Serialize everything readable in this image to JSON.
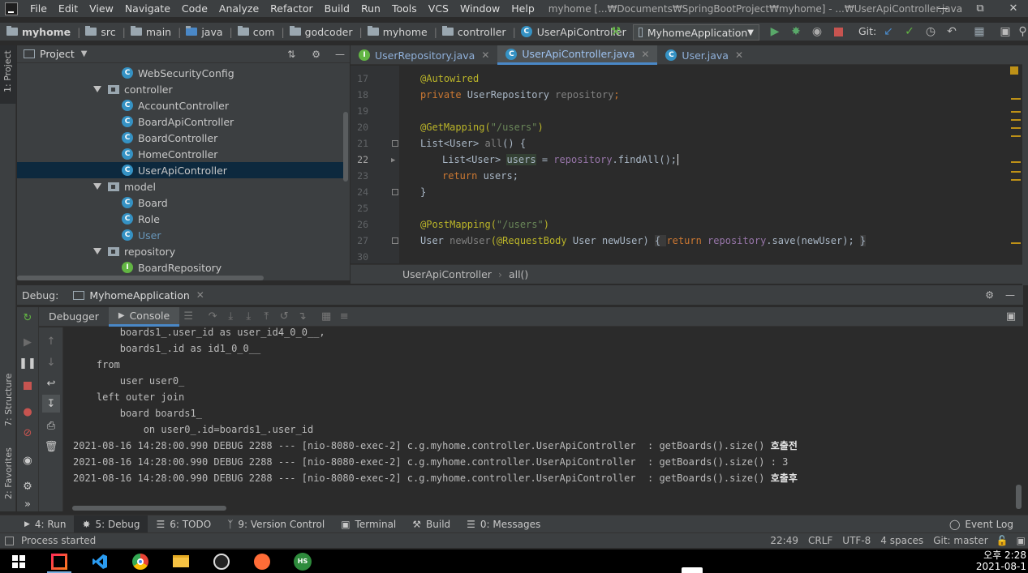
{
  "window": {
    "title": "myhome [...₩Documents₩SpringBootProject₩myhome] - ...₩UserApiController.java"
  },
  "menu": [
    "File",
    "Edit",
    "View",
    "Navigate",
    "Code",
    "Analyze",
    "Refactor",
    "Build",
    "Run",
    "Tools",
    "VCS",
    "Window",
    "Help"
  ],
  "breadcrumb": [
    "myhome",
    "src",
    "main",
    "java",
    "com",
    "godcoder",
    "myhome",
    "controller",
    "UserApiController"
  ],
  "toolbar": {
    "run_config": "MyhomeApplication",
    "git_label": "Git:"
  },
  "project_panel": {
    "title": "Project",
    "tree": [
      {
        "label": "WebSecurityConfig",
        "kind": "class"
      },
      {
        "label": "controller",
        "kind": "package"
      },
      {
        "label": "AccountController",
        "kind": "class"
      },
      {
        "label": "BoardApiController",
        "kind": "class"
      },
      {
        "label": "BoardController",
        "kind": "class"
      },
      {
        "label": "HomeController",
        "kind": "class"
      },
      {
        "label": "UserApiController",
        "kind": "class",
        "selected": true
      },
      {
        "label": "model",
        "kind": "package"
      },
      {
        "label": "Board",
        "kind": "class"
      },
      {
        "label": "Role",
        "kind": "class"
      },
      {
        "label": "User",
        "kind": "class"
      },
      {
        "label": "repository",
        "kind": "package"
      },
      {
        "label": "BoardRepository",
        "kind": "interface"
      }
    ]
  },
  "editor": {
    "tabs": [
      {
        "label": "UserRepository.java",
        "kind": "interface"
      },
      {
        "label": "UserApiController.java",
        "kind": "class",
        "active": true
      },
      {
        "label": "User.java",
        "kind": "class"
      }
    ],
    "line_numbers": [
      "17",
      "18",
      "19",
      "20",
      "21",
      "22",
      "23",
      "24",
      "25",
      "26",
      "27",
      "30"
    ],
    "code": {
      "l17_ann": "@Autowired",
      "l18_kw": "private",
      "l18_type": " UserRepository ",
      "l18_field": "repository",
      "l18_end": ";",
      "l20_ann": "@GetMapping(",
      "l20_str": "\"/users\"",
      "l20_end": ")",
      "l21_type": "List<User> ",
      "l21_name": "all",
      "l21_end": "() {",
      "l22_type": "List<User> ",
      "l22_var": "users",
      "l22_mid": " = ",
      "l22_field": "repository",
      "l22_call": ".findAll();",
      "l23_kw": "return",
      "l23_end": " users;",
      "l24": "}",
      "l26_ann": "@PostMapping(",
      "l26_str": "\"/users\"",
      "l26_end": ")",
      "l27_type": "User ",
      "l27_name": "newUser",
      "l27_ann": "(@RequestBody",
      "l27_mid": " User newUser) ",
      "l27_b1": "{ ",
      "l27_kw": "return",
      "l27_sp": " ",
      "l27_field": "repository",
      "l27_call": ".save(newUser); ",
      "l27_b2": "}"
    },
    "crumb": [
      "UserApiController",
      "all()"
    ]
  },
  "debug": {
    "label": "Debug:",
    "session": "MyhomeApplication",
    "tabs": [
      "Debugger",
      "Console"
    ],
    "console_lines": [
      "        boards1_.user_id as user_id4_0_0__,",
      "        boards1_.id as id1_0_0__",
      "    from",
      "        user user0_",
      "    left outer join",
      "        board boards1_",
      "            on user0_.id=boards1_.user_id"
    ],
    "log_lines": [
      {
        "prefix": "2021-08-16 14:28:00.990 DEBUG 2288 --- [nio-8080-exec-2] c.g.myhome.controller.UserApiController  : getBoards().size() ",
        "suffix": "호출전"
      },
      {
        "prefix": "2021-08-16 14:28:00.990 DEBUG 2288 --- [nio-8080-exec-2] c.g.myhome.controller.UserApiController  : getBoards().size() : 3",
        "suffix": ""
      },
      {
        "prefix": "2021-08-16 14:28:00.990 DEBUG 2288 --- [nio-8080-exec-2] c.g.myhome.controller.UserApiController  : getBoards().size() ",
        "suffix": "호출후"
      }
    ]
  },
  "side_labels": {
    "project": "1: Project",
    "structure": "7: Structure",
    "favorites": "2: Favorites"
  },
  "bottom_tabs": [
    "4: Run",
    "5: Debug",
    "6: TODO",
    "9: Version Control",
    "Terminal",
    "Build",
    "0: Messages"
  ],
  "event_log": "Event Log",
  "status": {
    "message": "Process started",
    "position": "22:49",
    "line_sep": "CRLF",
    "encoding": "UTF-8",
    "indent": "4 spaces",
    "git": "Git: master"
  },
  "taskbar": {
    "time": "오후 2:28",
    "date": "2021-08-1"
  },
  "colors": {
    "accent": "#4a88c7",
    "selection": "#0d293e",
    "class_icon": "#3592c4",
    "interface_icon": "#62b543"
  }
}
